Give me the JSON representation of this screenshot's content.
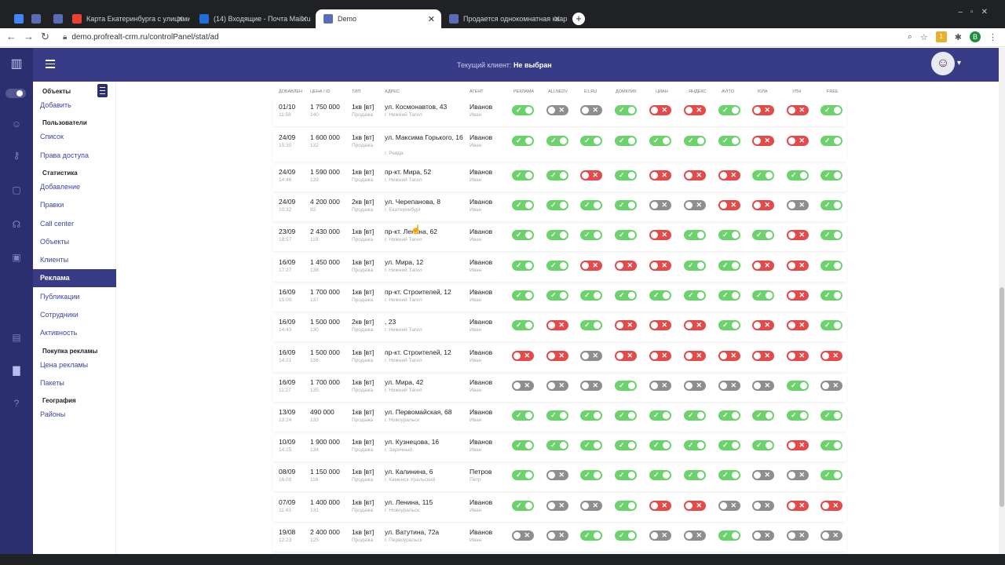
{
  "browser": {
    "tabs": [
      {
        "title": "",
        "favicon": "#4285f4"
      },
      {
        "title": "",
        "favicon": "#5b6bb5"
      },
      {
        "title": "",
        "favicon": "#5b6bb5"
      },
      {
        "title": "Карта Екатеринбурга с улицами",
        "favicon": "#e94235"
      },
      {
        "title": "(14) Входящие - Почта Mail.ru",
        "favicon": "#1e6fd9"
      },
      {
        "title": "Demo",
        "favicon": "#5b6bb5"
      },
      {
        "title": "Продается однокомнатная квар",
        "favicon": "#5b6bb5"
      }
    ],
    "url": "demo.profrealt-crm.ru/controlPanel/stat/ad",
    "profile_letter": "B",
    "ext_badge": "1"
  },
  "header": {
    "client_label": "Текущий клиент:",
    "client_value": "Не выбран"
  },
  "sidebar": {
    "sections": [
      {
        "title": "Объекты",
        "items": [
          "Добавить"
        ]
      },
      {
        "title": "Пользователи",
        "items": [
          "Список",
          "Права доступа"
        ]
      },
      {
        "title": "Статистика",
        "items": [
          "Добавление",
          "Правки",
          "Call center",
          "Объекты",
          "Клиенты",
          "Реклама",
          "Публикации",
          "Сотрудники",
          "Активность"
        ]
      },
      {
        "title": "Покупка рекламы",
        "items": [
          "Цена рекламы",
          "Пакеты"
        ]
      },
      {
        "title": "География",
        "items": [
          "Районы"
        ]
      }
    ],
    "active_item": "Реклама"
  },
  "table": {
    "columns": [
      "Добавлен",
      "Цена / ID",
      "Тип",
      "Адрес",
      "Агент",
      "Реклама",
      "ALLNEDV",
      "E1.RU",
      "ДОМКЛИК",
      "ЦИАН",
      "ЯНДЕКС",
      "AVITO",
      "ЮЛА",
      "УПН",
      "FREE"
    ],
    "rows": [
      {
        "date": "01/10",
        "time": "11:58",
        "price": "1 750 000",
        "id": "140",
        "type": "1кв [вт]",
        "deal": "Продажа",
        "address": "ул. Космонавтов, 43",
        "city": "г. Нижний Тагил",
        "agent": "Иванов",
        "agent_first": "Иван",
        "status": [
          "on",
          "na",
          "na",
          "on",
          "off",
          "off",
          "on",
          "off",
          "off",
          "on"
        ]
      },
      {
        "date": "24/09",
        "time": "15:30",
        "price": "1 600 000",
        "id": "132",
        "type": "1кв [вт]",
        "deal": "Продажа",
        "address": "ул. Максима Горького, 16",
        "city": "г. Ревда",
        "agent": "Иванов",
        "agent_first": "Иван",
        "status": [
          "on",
          "on",
          "on",
          "on",
          "on",
          "on",
          "on",
          "off",
          "off",
          "on"
        ]
      },
      {
        "date": "24/09",
        "time": "14:46",
        "price": "1 590 000",
        "id": "139",
        "type": "1кв [вт]",
        "deal": "Продажа",
        "address": "пр-кт. Мира, 52",
        "city": "г. Нижний Тагил",
        "agent": "Иванов",
        "agent_first": "Иван",
        "status": [
          "on",
          "on",
          "off",
          "on",
          "off",
          "off",
          "off",
          "on",
          "on",
          "on"
        ]
      },
      {
        "date": "24/09",
        "time": "10:32",
        "price": "4 200 000",
        "id": "92",
        "type": "2кв [вт]",
        "deal": "Продажа",
        "address": "ул. Черепанова, 8",
        "city": "г. Екатеринбург",
        "agent": "Иванов",
        "agent_first": "Иван",
        "status": [
          "on",
          "on",
          "on",
          "on",
          "na",
          "na",
          "off",
          "off",
          "na",
          "on"
        ]
      },
      {
        "date": "23/09",
        "time": "18:57",
        "price": "2 430 000",
        "id": "119",
        "type": "1кв [вт]",
        "deal": "Продажа",
        "address": "пр-кт. Ленина, 62",
        "city": "г. Нижний Тагил",
        "agent": "Иванов",
        "agent_first": "Иван",
        "status": [
          "on",
          "on",
          "on",
          "on",
          "off",
          "on",
          "on",
          "on",
          "off",
          "on"
        ]
      },
      {
        "date": "16/09",
        "time": "17:27",
        "price": "1 450 000",
        "id": "138",
        "type": "1кв [вт]",
        "deal": "Продажа",
        "address": "ул. Мира, 12",
        "city": "г. Нижний Тагил",
        "agent": "Иванов",
        "agent_first": "Иван",
        "status": [
          "on",
          "on",
          "off",
          "off",
          "off",
          "on",
          "on",
          "off",
          "off",
          "on"
        ]
      },
      {
        "date": "16/09",
        "time": "15:00",
        "price": "1 700 000",
        "id": "137",
        "type": "1кв [вт]",
        "deal": "Продажа",
        "address": "пр-кт. Строителей, 12",
        "city": "г. Нижний Тагил",
        "agent": "Иванов",
        "agent_first": "Иван",
        "status": [
          "on",
          "on",
          "on",
          "on",
          "on",
          "on",
          "on",
          "on",
          "off",
          "on"
        ]
      },
      {
        "date": "16/09",
        "time": "14:43",
        "price": "1 500 000",
        "id": "130",
        "type": "2кв [вт]",
        "deal": "Продажа",
        "address": ", 23",
        "city": "г. Нижний Тагил",
        "agent": "Иванов",
        "agent_first": "Иван",
        "status": [
          "on",
          "off",
          "on",
          "off",
          "off",
          "off",
          "on",
          "off",
          "off",
          "on"
        ]
      },
      {
        "date": "16/09",
        "time": "14:21",
        "price": "1 500 000",
        "id": "136",
        "type": "1кв [вт]",
        "deal": "Продажа",
        "address": "пр-кт. Строителей, 12",
        "city": "г. Нижний Тагил",
        "agent": "Иванов",
        "agent_first": "Иван",
        "status": [
          "off",
          "off",
          "na",
          "off",
          "off",
          "off",
          "off",
          "off",
          "off",
          "off"
        ]
      },
      {
        "date": "16/09",
        "time": "11:27",
        "price": "1 700 000",
        "id": "135",
        "type": "1кв [вт]",
        "deal": "Продажа",
        "address": "ул. Мира, 42",
        "city": "г. Нижний Тагил",
        "agent": "Иванов",
        "agent_first": "Иван",
        "status": [
          "na",
          "na",
          "na",
          "on",
          "na",
          "na",
          "na",
          "na",
          "on",
          "na"
        ]
      },
      {
        "date": "13/09",
        "time": "13:24",
        "price": "490 000",
        "id": "133",
        "type": "1кв [вт]",
        "deal": "Продажа",
        "address": "ул. Первомайская, 68",
        "city": "г. Новоуральск",
        "agent": "Иванов",
        "agent_first": "Иван",
        "status": [
          "on",
          "on",
          "on",
          "on",
          "on",
          "on",
          "on",
          "on",
          "on",
          "on"
        ]
      },
      {
        "date": "10/09",
        "time": "14:25",
        "price": "1 900 000",
        "id": "134",
        "type": "1кв [вт]",
        "deal": "Продажа",
        "address": "ул. Кузнецова, 16",
        "city": "г. Заречный",
        "agent": "Иванов",
        "agent_first": "Иван",
        "status": [
          "on",
          "on",
          "on",
          "on",
          "on",
          "on",
          "on",
          "on",
          "off",
          "on"
        ]
      },
      {
        "date": "08/09",
        "time": "16:09",
        "price": "1 150 000",
        "id": "116",
        "type": "1кв [вт]",
        "deal": "Продажа",
        "address": "ул. Калинина, 6",
        "city": "г. Каменск-Уральский",
        "agent": "Петров",
        "agent_first": "Петр",
        "status": [
          "on",
          "na",
          "on",
          "on",
          "on",
          "on",
          "on",
          "na",
          "na",
          "on"
        ]
      },
      {
        "date": "07/09",
        "time": "11:43",
        "price": "1 400 000",
        "id": "131",
        "type": "1кв [вт]",
        "deal": "Продажа",
        "address": "ул. Ленина, 115",
        "city": "г. Новоуральск",
        "agent": "Иванов",
        "agent_first": "Иван",
        "status": [
          "on",
          "na",
          "na",
          "on",
          "off",
          "off",
          "na",
          "na",
          "off",
          "off"
        ]
      },
      {
        "date": "19/08",
        "time": "12:23",
        "price": "2 400 000",
        "id": "125",
        "type": "1кв [вт]",
        "deal": "Продажа",
        "address": "ул. Ватутина, 72а",
        "city": "г. Первоуральск",
        "agent": "Иванов",
        "agent_first": "Иван",
        "status": [
          "na",
          "na",
          "on",
          "on",
          "na",
          "na",
          "on",
          "na",
          "na",
          "na"
        ]
      }
    ]
  },
  "colors": {
    "accent": "#383c86",
    "rail": "#2b2e6f",
    "on": "#6cd36c",
    "off": "#e34a4a",
    "na": "#8e8e8e"
  },
  "icons": {
    "on": "check-icon",
    "off": "cross-icon"
  }
}
